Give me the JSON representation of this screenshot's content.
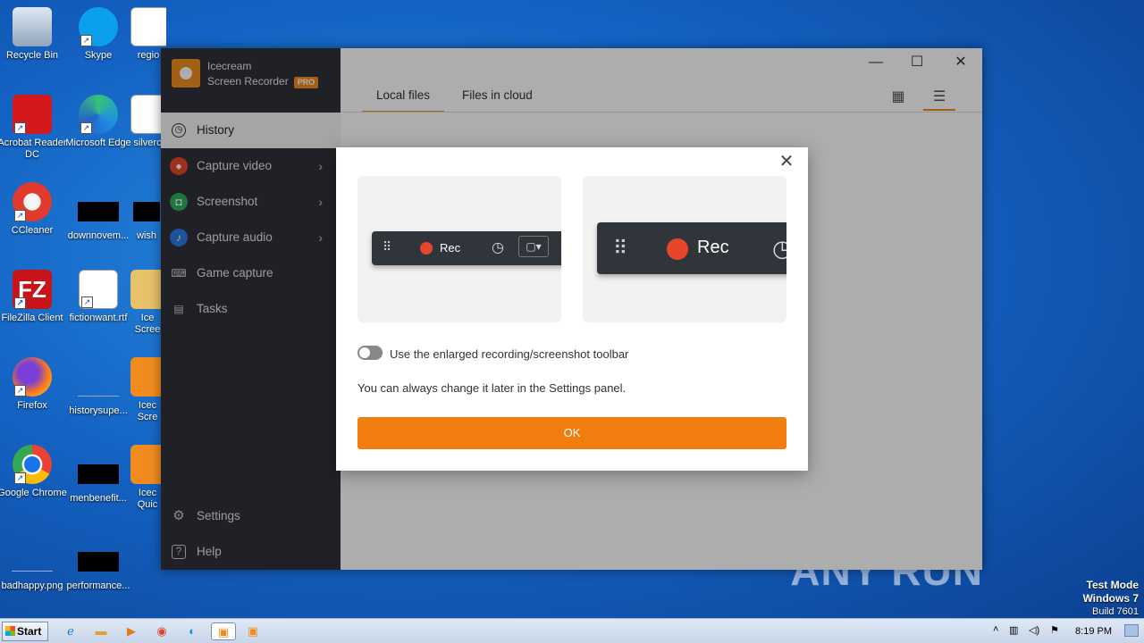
{
  "desktop": {
    "icons": [
      {
        "label": "Recycle Bin"
      },
      {
        "label": "Skype"
      },
      {
        "label": "regio"
      },
      {
        "label": "Acrobat Reader DC"
      },
      {
        "label": "Microsoft Edge"
      },
      {
        "label": "silverc"
      },
      {
        "label": "CCleaner"
      },
      {
        "label": "downnovem..."
      },
      {
        "label": "wish"
      },
      {
        "label": "FileZilla Client"
      },
      {
        "label": "fictionwant.rtf"
      },
      {
        "label": "Ice Scree"
      },
      {
        "label": "Firefox"
      },
      {
        "label": "historysupe..."
      },
      {
        "label": "Icec Scre"
      },
      {
        "label": "Google Chrome"
      },
      {
        "label": "menbenefit..."
      },
      {
        "label": "Icec Quic"
      },
      {
        "label": "badhappy.png"
      },
      {
        "label": "performance..."
      }
    ]
  },
  "app": {
    "brand_name": "Icecream",
    "brand_product": "Screen Recorder",
    "brand_badge": "PRO",
    "nav": [
      {
        "label": "History",
        "icon": "clock-icon"
      },
      {
        "label": "Capture video",
        "icon": "record-icon"
      },
      {
        "label": "Screenshot",
        "icon": "camera-icon"
      },
      {
        "label": "Capture audio",
        "icon": "microphone-icon"
      },
      {
        "label": "Game capture",
        "icon": "gamepad-icon"
      },
      {
        "label": "Tasks",
        "icon": "document-icon"
      },
      {
        "label": "Settings",
        "icon": "gear-icon"
      },
      {
        "label": "Help",
        "icon": "help-icon"
      }
    ],
    "tabs": [
      {
        "label": "Local files",
        "active": true
      },
      {
        "label": "Files in cloud",
        "active": false
      }
    ],
    "window_controls": {
      "minimize": "—",
      "maximize": "☐",
      "close": "✕"
    }
  },
  "dialog": {
    "close_symbol": "✕",
    "rec_label_small": "Rec",
    "rec_label_large": "Rec",
    "option_label": "Use the enlarged recording/screenshot toolbar",
    "option_enabled": false,
    "hint": "You can always change it later in the Settings panel.",
    "ok_label": "OK"
  },
  "taskbar": {
    "start_label": "Start",
    "clock": "8:19 PM"
  },
  "watermark": "ANY  RUN",
  "test_mode": {
    "line1": "Test Mode",
    "line2": "Windows 7",
    "line3": "Build 7601"
  },
  "colors": {
    "accent": "#f07d0e",
    "sidebar": "#2e3238",
    "rec_red": "#e8462c"
  }
}
